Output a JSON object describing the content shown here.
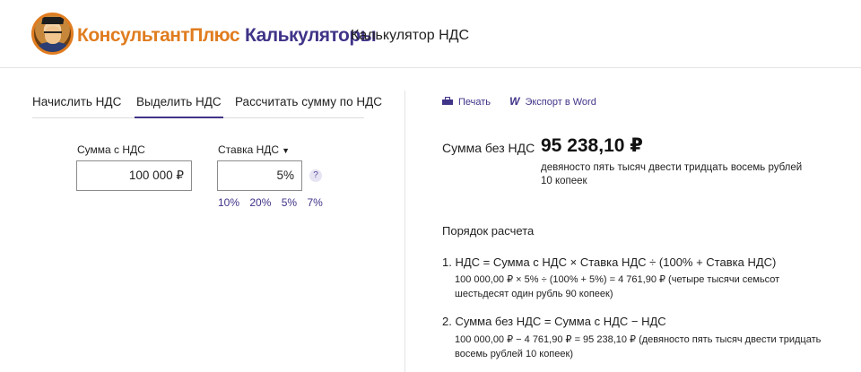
{
  "header": {
    "brand_part1": "КонсультантПлюс",
    "brand_part2": "Калькуляторы",
    "page_title": "Калькулятор НДС"
  },
  "tabs": [
    {
      "label": "Начислить НДС",
      "active": false
    },
    {
      "label": "Выделить НДС",
      "active": true
    },
    {
      "label": "Рассчитать сумму по НДС",
      "active": false
    }
  ],
  "form": {
    "amount_label": "Сумма с НДС",
    "amount_value": "100 000 ₽",
    "rate_label": "Ставка НДС",
    "rate_value": "5%",
    "help": "?",
    "rate_options": [
      "10%",
      "20%",
      "5%",
      "7%"
    ]
  },
  "actions": {
    "print_label": "Печать",
    "export_label": "Экспорт в Word"
  },
  "result": {
    "label": "Сумма без НДС",
    "value": "95 238,10 ₽",
    "words": "девяносто пять тысяч двести тридцать восемь рублей 10 копеек"
  },
  "order": {
    "title": "Порядок расчета",
    "steps": [
      {
        "formula": "1. НДС = Сумма с НДС × Ставка НДС ÷ (100% + Ставка НДС)",
        "calc": "100 000,00 ₽ × 5% ÷ (100% + 5%) = 4 761,90 ₽ (четыре тысячи семьсот шестьдесят один рубль 90 копеек)"
      },
      {
        "formula": "2. Сумма без НДС = Сумма с НДС − НДС",
        "calc": "100 000,00 ₽ − 4 761,90 ₽ = 95 238,10 ₽ (девяносто пять тысяч двести тридцать восемь рублей 10 копеек)"
      }
    ]
  },
  "colors": {
    "accent": "#3f3488",
    "brand_orange": "#e07c1f"
  },
  "icons": [
    "consultant-logo-icon",
    "printer-icon",
    "word-icon",
    "help-icon",
    "caret-down-icon"
  ]
}
